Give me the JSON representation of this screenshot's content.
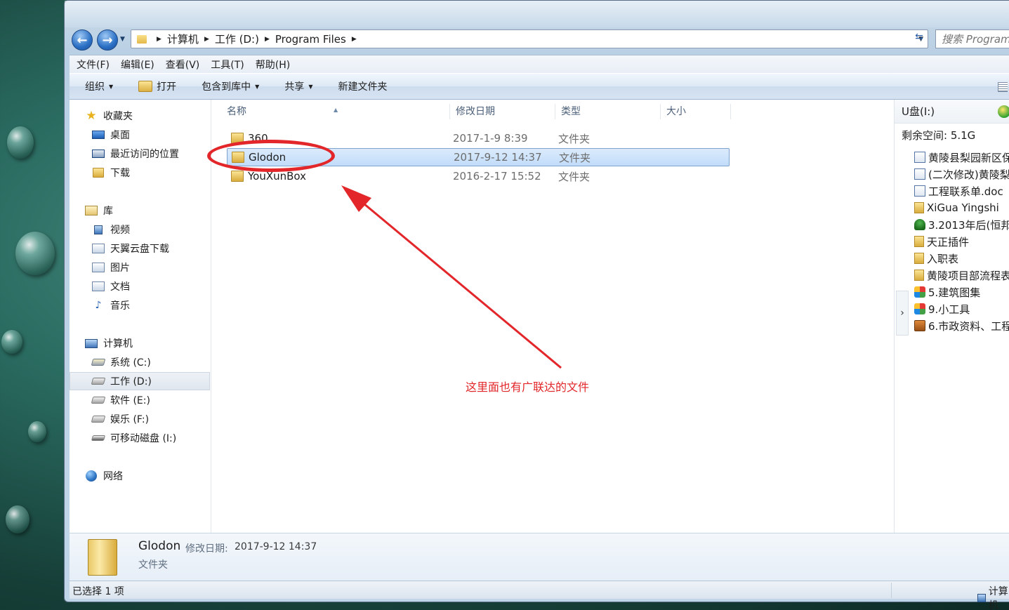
{
  "window": {
    "breadcrumb": [
      "计算机",
      "工作 (D:)",
      "Program Files"
    ],
    "search_placeholder": "搜索 Program Files"
  },
  "menubar": [
    "文件(F)",
    "编辑(E)",
    "查看(V)",
    "工具(T)",
    "帮助(H)"
  ],
  "commandbar": {
    "organize": "组织",
    "open": "打开",
    "include_library": "包含到库中",
    "share": "共享",
    "new_folder": "新建文件夹"
  },
  "navpane": {
    "favorites": {
      "label": "收藏夹",
      "items": [
        "桌面",
        "最近访问的位置",
        "下载"
      ]
    },
    "libraries": {
      "label": "库",
      "items": [
        "视频",
        "天翼云盘下载",
        "图片",
        "文档",
        "音乐"
      ]
    },
    "computer": {
      "label": "计算机",
      "items": [
        "系统 (C:)",
        "工作 (D:)",
        "软件 (E:)",
        "娱乐 (F:)",
        "可移动磁盘 (I:)"
      ]
    },
    "network": {
      "label": "网络"
    }
  },
  "columns": {
    "name": "名称",
    "modified": "修改日期",
    "type": "类型",
    "size": "大小"
  },
  "files": [
    {
      "name": "360",
      "modified": "2017-1-9 8:39",
      "type": "文件夹",
      "selected": false
    },
    {
      "name": "Glodon",
      "modified": "2017-9-12 14:37",
      "type": "文件夹",
      "selected": true
    },
    {
      "name": "YouXunBox",
      "modified": "2016-2-17 15:52",
      "type": "文件夹",
      "selected": false
    }
  ],
  "annotation": {
    "text": "这里面也有广联达的文件",
    "color": "#e2262a"
  },
  "preview": {
    "drive": "U盘(I:)",
    "free_space": "剩余空间: 5.1G",
    "items": [
      {
        "name": "黄陵县梨园新区保",
        "icon": "doc"
      },
      {
        "name": "(二次修改)黄陵梨",
        "icon": "doc"
      },
      {
        "name": "工程联系单.doc",
        "icon": "doc"
      },
      {
        "name": "XiGua Yingshi",
        "icon": "folder"
      },
      {
        "name": "3.2013年后(恒邦",
        "icon": "tree"
      },
      {
        "name": "天正插件",
        "icon": "folder"
      },
      {
        "name": "入职表",
        "icon": "folder"
      },
      {
        "name": "黄陵项目部流程表",
        "icon": "folder"
      },
      {
        "name": "5.建筑图集",
        "icon": "app"
      },
      {
        "name": "9.小工具",
        "icon": "app"
      },
      {
        "name": "6.市政资料、工程",
        "icon": "box"
      }
    ]
  },
  "details": {
    "name": "Glodon",
    "modified_label": "修改日期:",
    "modified_value": "2017-9-12 14:37",
    "type": "文件夹"
  },
  "statusbar": {
    "selected_text": "已选择 1 项",
    "location": "计算机"
  }
}
